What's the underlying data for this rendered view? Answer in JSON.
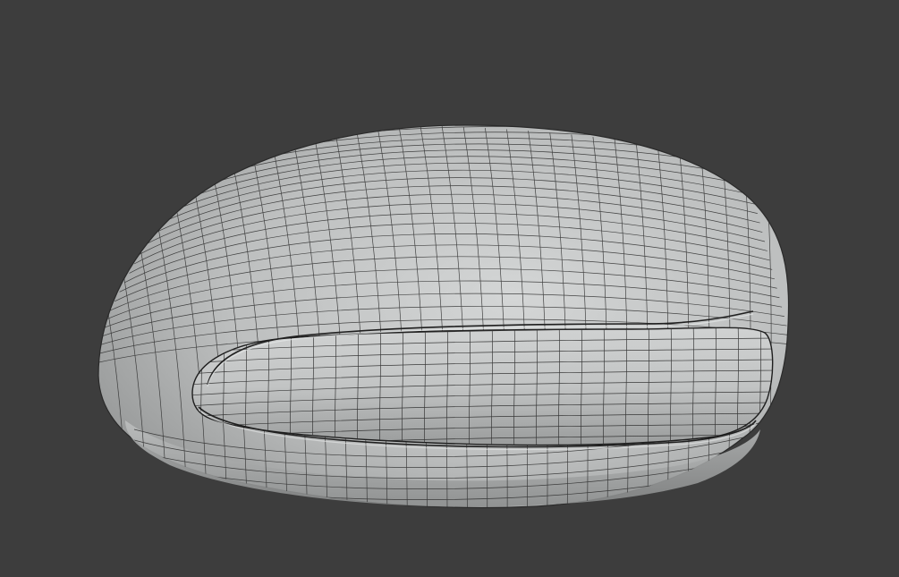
{
  "viewport": {
    "background_color": "#3d3d3d",
    "object": {
      "kind": "wireframe-mesh",
      "shading": "solid-gray",
      "surface_color": "#c8caca",
      "edge_color": "#2a2a2a"
    }
  }
}
